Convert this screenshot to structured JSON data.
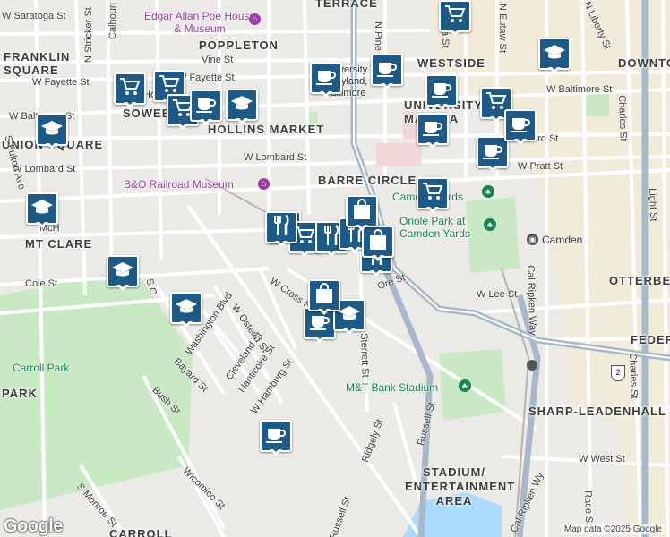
{
  "neighborhoods": [
    "TERRACE",
    "POPPLETON",
    "FRANKLIN SQUARE",
    "WESTSIDE",
    "DOWNTO",
    "SOWEB",
    "HOLLINS MARKET",
    "UNIVERSITY OF MARYLA",
    "UNION SQUARE",
    "BARRE CIRCLE",
    "MT CLARE",
    "OTTERBEIN",
    "FEDER",
    "PARK",
    "SHARP-LEADENHALL",
    "STADIUM/ ENTERTAINMENT AREA",
    "CARROLL"
  ],
  "streets": [
    "W Saratoga St",
    "Calhoun St",
    "N Stricker St",
    "N Pine St",
    "N Paca St",
    "N Eutaw St",
    "N Liberty St",
    "Vine St",
    "W Fayette St",
    "W Fayette St",
    "W Baltimore St",
    "W Baltimore St",
    "Hollins St",
    "W Lombard St",
    "W Lombard St",
    "W Pratt St",
    "W Lee St",
    "Cole St",
    "S Fulton Ave",
    "Washington Blvd",
    "W Ostend St",
    "Cleveland St",
    "Nanticoke St",
    "W Hamburg St",
    "Bayard St",
    "Bush St",
    "Sterrett St",
    "Ridgely St",
    "Russell St",
    "Russell St",
    "Wicomico St",
    "S Monroe St",
    "Cal Ripken Way",
    "Cal Ripken Wy",
    "Light St",
    "Charles St",
    "Charles St",
    "W West St",
    "Race St",
    "W Cross St",
    "S C",
    "McH",
    "Camden",
    "ard St",
    "Ore St"
  ],
  "pois": {
    "poe_house": "Edgar Allan Poe House & Museum",
    "bo_museum": "B&O Railroad Museum",
    "camden_yards": "Camden Yards",
    "oriole_park": "Oriole Park at Camden Yards",
    "camden_station": "Camden",
    "mt_stadium": "M&T Bank Stadium",
    "carroll_park": "Carroll Park",
    "univ_label": "University of Maryland, Baltimore"
  },
  "route_shield": "2",
  "markers": [
    {
      "icon": "cart-icon"
    },
    {
      "icon": "cart-icon"
    },
    {
      "icon": "cart-icon"
    },
    {
      "icon": "cart-icon"
    },
    {
      "icon": "cart-icon"
    },
    {
      "icon": "cart-icon"
    },
    {
      "icon": "cart-icon"
    },
    {
      "icon": "cart-icon"
    },
    {
      "icon": "coffee-icon"
    },
    {
      "icon": "coffee-icon"
    },
    {
      "icon": "coffee-icon"
    },
    {
      "icon": "coffee-icon"
    },
    {
      "icon": "coffee-icon"
    },
    {
      "icon": "coffee-icon"
    },
    {
      "icon": "coffee-icon"
    },
    {
      "icon": "coffee-icon"
    },
    {
      "icon": "coffee-icon"
    },
    {
      "icon": "school-icon"
    },
    {
      "icon": "school-icon"
    },
    {
      "icon": "school-icon"
    },
    {
      "icon": "school-icon"
    },
    {
      "icon": "school-icon"
    },
    {
      "icon": "school-icon"
    },
    {
      "icon": "school-icon"
    },
    {
      "icon": "restaurant-icon"
    },
    {
      "icon": "restaurant-icon"
    },
    {
      "icon": "restaurant-icon"
    },
    {
      "icon": "restaurant-icon"
    },
    {
      "icon": "bag-icon"
    },
    {
      "icon": "bag-icon"
    },
    {
      "icon": "bag-icon"
    }
  ],
  "google_logo": "Google",
  "attribution": "Map data ©2025 Google",
  "colors": {
    "marker": "#1e5a87",
    "park": "#c9e9c4",
    "highway": "#a8b8c8",
    "water": "#aadaff",
    "road": "#ffffff"
  }
}
